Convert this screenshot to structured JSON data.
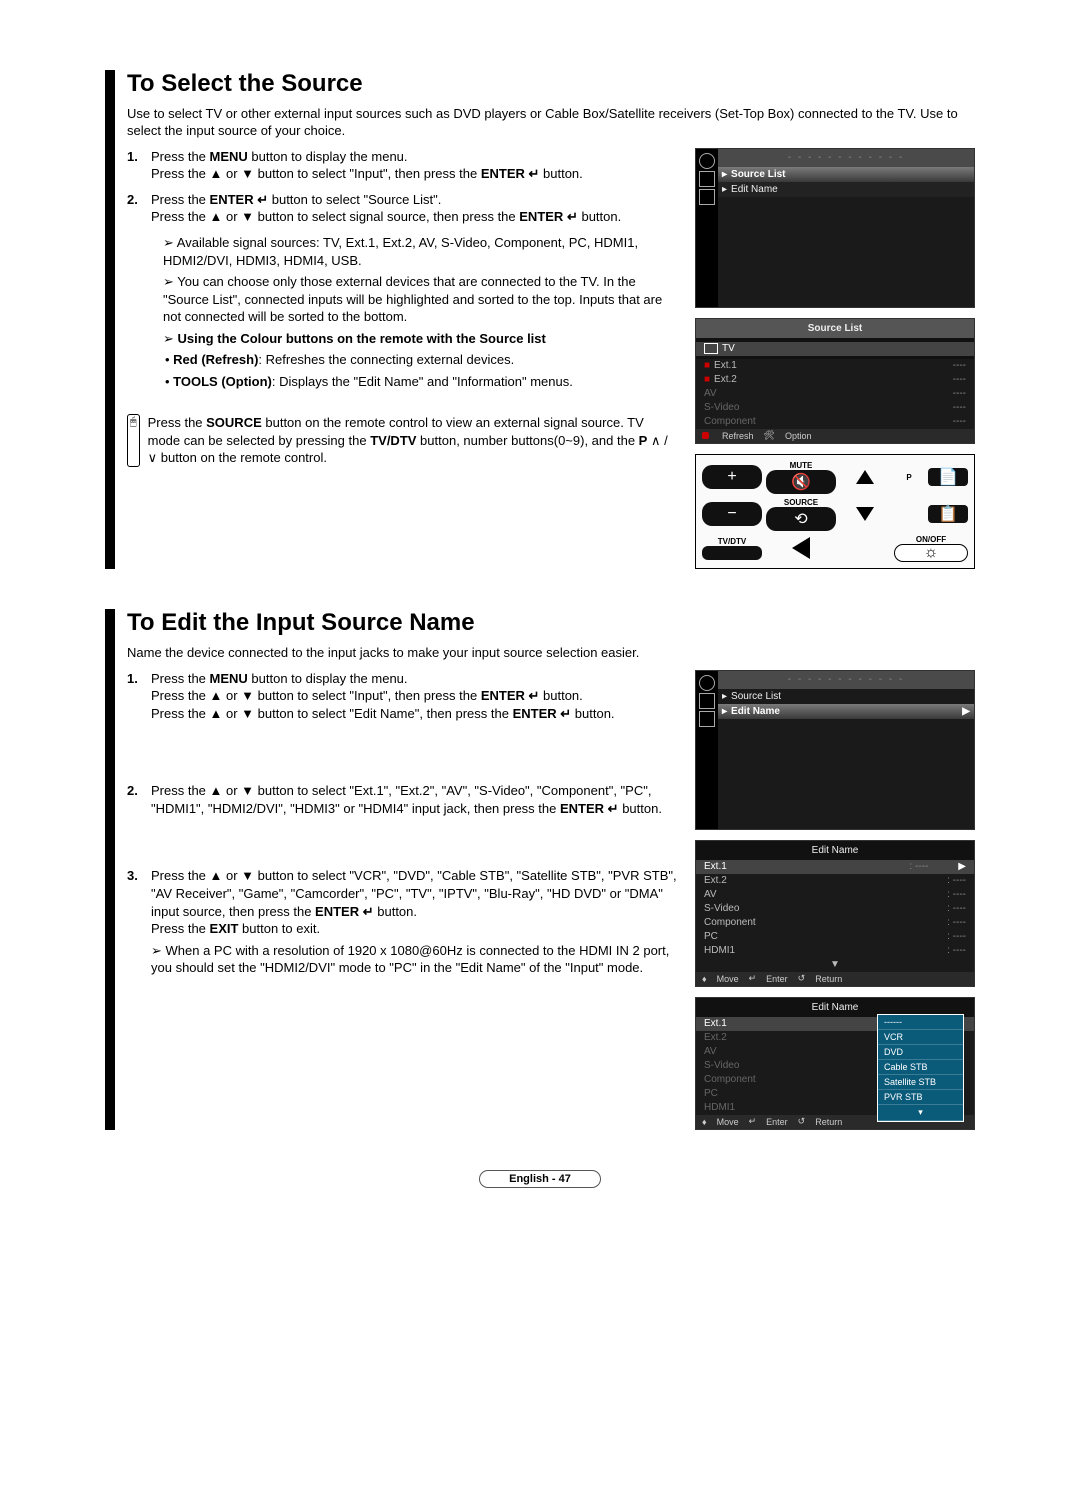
{
  "section1": {
    "title": "To Select the Source",
    "intro": "Use to select TV or other external input sources such as DVD players or Cable Box/Satellite receivers (Set-Top Box) connected to the TV. Use to select the input source of your choice.",
    "step1_num": "1.",
    "step1_a": "Press the ",
    "step1_menu": "MENU",
    "step1_b": " button to display the menu.",
    "step1_c": "Press the ▲ or ▼ button to select \"Input\", then press the ",
    "step1_enter": "ENTER",
    "step1_icon": "↵",
    "step1_d": " button.",
    "step2_num": "2.",
    "step2_a": "Press the ",
    "step2_b": " button to select \"Source List\".",
    "step2_c": "Press the ▲ or ▼ button to select signal source, then press the ",
    "step2_d": " button.",
    "note1": "Available signal sources: TV, Ext.1, Ext.2, AV, S-Video, Component, PC, HDMI1, HDMI2/DVI, HDMI3, HDMI4, USB.",
    "note2": "You can choose only those external devices that are connected to the TV. In the \"Source List\", connected inputs will be highlighted and sorted to the top. Inputs that are not connected will be sorted to the bottom.",
    "note3_bold": "Using the Colour buttons on the remote with the Source list",
    "bullet1_bold": "Red (Refresh)",
    "bullet1_rest": ": Refreshes the connecting external devices.",
    "bullet2_bold": "TOOLS (Option)",
    "bullet2_rest": ": Displays the \"Edit Name\" and \"Information\" menus.",
    "remote_a": "Press the ",
    "remote_src": "SOURCE",
    "remote_b": " button on the remote control to view an external signal source. TV mode can be selected by pressing the ",
    "remote_tvdtv": "TV/DTV",
    "remote_c": " button, number buttons(0~9), and the ",
    "remote_p": "P",
    "remote_updown": " ∧ / ∨ ",
    "remote_d": "button on the remote control."
  },
  "osd1": {
    "source_list": "Source List",
    "edit_name": "Edit Name"
  },
  "osd2": {
    "title": "Source List",
    "tv": "TV",
    "ext1": "Ext.1",
    "ext2": "Ext.2",
    "av": "AV",
    "svideo": "S-Video",
    "component": "Component",
    "dash": "----",
    "refresh": "Refresh",
    "option": "Option"
  },
  "remote": {
    "mute": "MUTE",
    "source": "SOURCE",
    "p": "P",
    "tvdtv": "TV/DTV",
    "onoff": "ON/OFF"
  },
  "section2": {
    "title": "To Edit the Input Source Name",
    "intro": "Name the device connected to the input jacks to make your input source selection easier.",
    "step1_num": "1.",
    "step1_a": "Press the ",
    "step1_menu": "MENU",
    "step1_b": " button to display the menu.",
    "step1_c": "Press the ▲ or ▼ button to select \"Input\", then press the ",
    "step1_enter": "ENTER",
    "step1_icon": "↵",
    "step1_d": " button.",
    "step1_e": "Press the ▲ or ▼ button to select \"Edit Name\", then press the ",
    "step1_f": " button.",
    "step2_num": "2.",
    "step2": "Press the ▲ or ▼ button to select \"Ext.1\", \"Ext.2\", \"AV\", \"S-Video\", \"Component\", \"PC\", \"HDMI1\", \"HDMI2/DVI\", \"HDMI3\" or \"HDMI4\" input jack, then press the ",
    "step2_b": " button.",
    "step3_num": "3.",
    "step3": "Press the ▲ or ▼ button to select \"VCR\", \"DVD\", \"Cable STB\", \"Satellite STB\", \"PVR STB\", \"AV Receiver\", \"Game\", \"Camcorder\", \"PC\", \"TV\", \"IPTV\", \"Blu-Ray\", \"HD DVD\" or \"DMA\" input source, then press the ",
    "step3_b": " button.",
    "step3_exit_a": "Press the ",
    "step3_exit": "EXIT",
    "step3_exit_b": " button to exit.",
    "note1": "When a PC with a resolution of 1920 x 1080@60Hz is connected to the HDMI IN 2 port, you should set the \"HDMI2/DVI\" mode to \"PC\" in the \"Edit Name\" of the \"Input\" mode."
  },
  "osd3": {
    "source_list": "Source List",
    "edit_name": "Edit Name"
  },
  "osd4": {
    "title": "Edit Name",
    "ext1": "Ext.1",
    "ext2": "Ext.2",
    "av": "AV",
    "svideo": "S-Video",
    "component": "Component",
    "pc": "PC",
    "hdmi1": "HDMI1",
    "dash": ": ----",
    "move": "Move",
    "enter": "Enter",
    "return": "Return"
  },
  "osd5": {
    "title": "Edit Name",
    "ext1": "Ext.1",
    "ext2": "Ext.2",
    "av": "AV",
    "svideo": "S-Video",
    "component": "Component",
    "pc": "PC",
    "hdmi1": "HDMI1",
    "dd_blank": "------",
    "dd_vcr": "VCR",
    "dd_dvd": "DVD",
    "dd_cable": "Cable STB",
    "dd_sat": "Satellite STB",
    "dd_pvr": "PVR STB",
    "move": "Move",
    "enter": "Enter",
    "return": "Return"
  },
  "footer": "English - 47"
}
